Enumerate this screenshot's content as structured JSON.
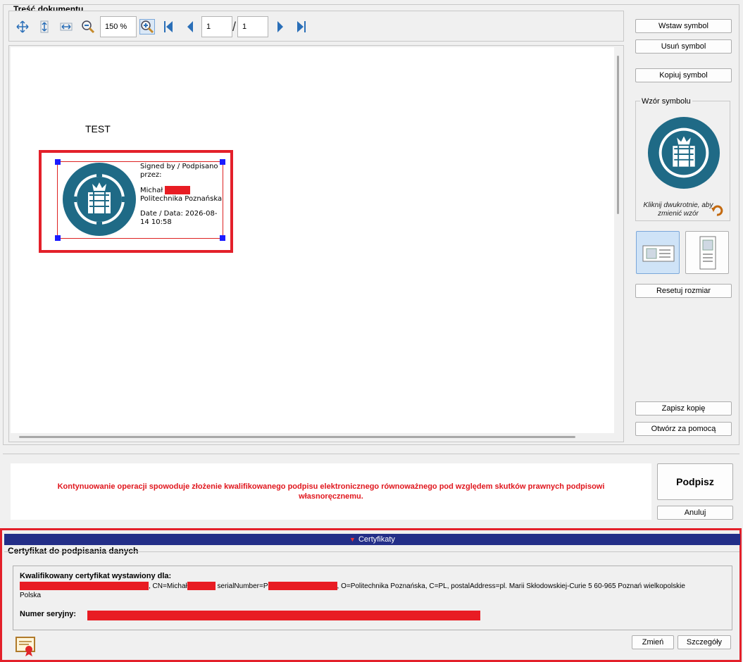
{
  "document_section": {
    "title": "Treść dokumentu",
    "toolbar": {
      "zoom_value": "150 %",
      "page_current": "1",
      "page_total": "1"
    },
    "page_text": "TEST",
    "signature": {
      "line1": "Signed by / Podpisano",
      "line2": "przez:",
      "name_first": "Michał",
      "org": "Politechnika Poznańska",
      "date_line1": "Date / Data: 2026-08-",
      "date_line2": "14 10:58"
    }
  },
  "right_panel": {
    "insert_symbol": "Wstaw symbol",
    "remove_symbol": "Usuń symbol",
    "copy_symbol": "Kopiuj symbol",
    "pattern_title": "Wzór symbolu",
    "pattern_hint": "Kliknij dwukrotnie, aby zmienić wzór",
    "reset_size": "Resetuj rozmiar",
    "save_copy": "Zapisz kopię",
    "open_with": "Otwórz za pomocą"
  },
  "warning": {
    "text": "Kontynuowanie operacji spowoduje złożenie kwalifikowanego podpisu elektronicznego równoważnego pod względem skutków prawnych podpisowi własnoręcznemu."
  },
  "actions": {
    "sign": "Podpisz",
    "cancel": "Anuluj"
  },
  "certificates": {
    "header": "Certyfikaty",
    "group_title": "Certyfikat do podpisania danych",
    "issued_for_label": "Kwalifikowany certyfikat wystawiony dla:",
    "cn_prefix": ", CN=Michał",
    "serial_prefix": "serialNumber=P",
    "details_rest": ", O=Politechnika Poznańska, C=PL, postalAddress=pl. Marii Skłodowskiej-Curie 5 60-965 Poznań wielkopolskie",
    "details_country": "Polska",
    "serial_label": "Numer seryjny:",
    "change": "Zmień",
    "details": "Szczegóły"
  },
  "colors": {
    "highlight_red": "#e3202a",
    "redaction": "#e81c23",
    "cert_header_bg": "#232e88",
    "warning_text": "#e0161d",
    "logo_teal": "#1f6a86"
  },
  "icons": [
    "fit-page-icon",
    "fit-height-icon",
    "fit-width-icon",
    "zoom-out-icon",
    "zoom-in-icon",
    "first-page-icon",
    "previous-page-icon",
    "next-page-icon",
    "last-page-icon",
    "undo-icon",
    "certificate-icon",
    "university-seal-icon"
  ]
}
